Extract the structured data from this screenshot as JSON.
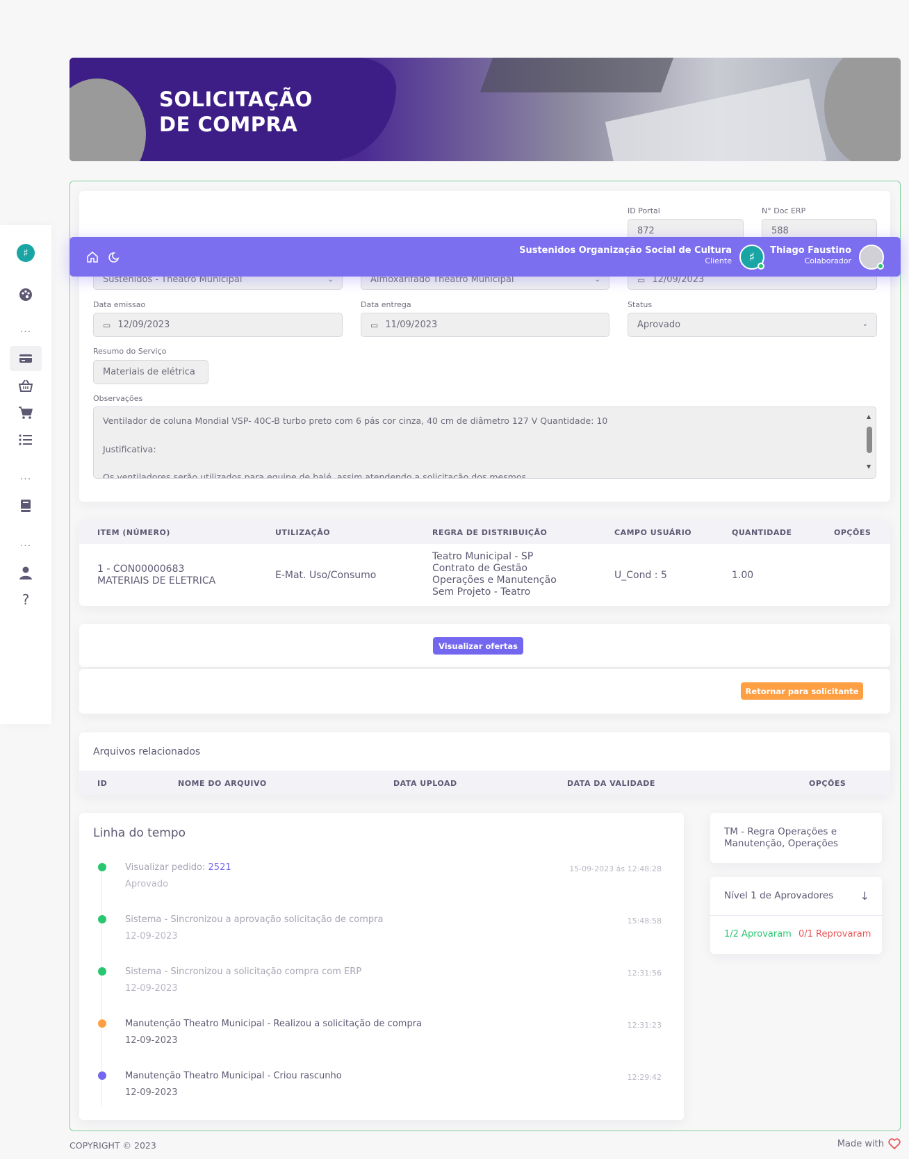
{
  "banner": {
    "title_line1": "SOLICITAÇÃO",
    "title_line2": "DE COMPRA"
  },
  "navbar": {
    "org_name": "Sustenidos Organização Social de Cultura",
    "org_role": "Cliente",
    "user_name": "Thiago Faustino",
    "user_role": "Colaborador"
  },
  "form": {
    "id_portal_label": "ID Portal",
    "id_portal_value": "872",
    "doc_erp_label": "N° Doc ERP",
    "doc_erp_value": "588",
    "filial_value": "Sustenidos - Theatro Municipal",
    "deposito_value": "Almoxarifado Theatro Municipal",
    "data_value": "12/09/2023",
    "data_emissao_label": "Data emissao",
    "data_emissao_value": "12/09/2023",
    "data_entrega_label": "Data entrega",
    "data_entrega_value": "11/09/2023",
    "status_label": "Status",
    "status_value": "Aprovado",
    "resumo_label": "Resumo do Serviço",
    "resumo_value": "Materiais de elétrica",
    "obs_label": "Observações",
    "obs_line1": "Ventilador de coluna Mondial VSP- 40C-B turbo preto com 6 pás cor cinza, 40 cm de diâmetro 127 V Quantidade: 10",
    "obs_line2": "Justificativa:",
    "obs_line3": "Os ventiladores serão utilizados para equipe de balé, assim atendendo a solicitação dos mesmos."
  },
  "items_table": {
    "headers": [
      "ITEM (NÚMERO)",
      "UTILIZAÇÃO",
      "REGRA DE DISTRIBUIÇÃO",
      "CAMPO USUÁRIO",
      "QUANTIDADE",
      "OPÇÕES"
    ],
    "row": {
      "item_line1": "1 - CON00000683",
      "item_line2": "MATERIAIS DE ELETRICA",
      "utilizacao": "E-Mat. Uso/Consumo",
      "regra_line1": "Teatro Municipal - SP",
      "regra_line2": "Contrato de Gestão",
      "regra_line3": "Operações e Manutenção",
      "regra_line4": "Sem Projeto - Teatro",
      "campo_usuario": "U_Cond : 5",
      "quantidade": "1.00"
    }
  },
  "actions": {
    "visualizar_ofertas": "Visualizar ofertas",
    "retornar": "Retornar para solicitante"
  },
  "files": {
    "title": "Arquivos relacionados",
    "headers": [
      "ID",
      "NOME DO ARQUIVO",
      "DATA UPLOAD",
      "DATA DA VALIDADE",
      "OPÇÕES"
    ]
  },
  "timeline": {
    "title": "Linha do tempo",
    "events": [
      {
        "title": "Visualizar pedido: ",
        "link": "2521",
        "sub": "Aprovado",
        "time": "15-09-2023 ás 12:48:28",
        "color": "#28c76f"
      },
      {
        "title": "Sistema - Sincronizou a aprovação solicitação de compra",
        "sub": "12-09-2023",
        "time": "15:48:58",
        "color": "#28c76f"
      },
      {
        "title": "Sistema - Sincronizou a solicitação compra com ERP",
        "sub": "12-09-2023",
        "time": "12:31:56",
        "color": "#28c76f"
      },
      {
        "title": "Manutenção Theatro Municipal - Realizou a solicitação de compra",
        "sub": "12-09-2023",
        "time": "12:31:23",
        "color": "#ff9f43"
      },
      {
        "title": "Manutenção Theatro Municipal - Criou rascunho",
        "sub": "12-09-2023",
        "time": "12:29:42",
        "color": "#7367f0"
      }
    ]
  },
  "approval": {
    "rule_line1": "TM - Regra Operações e",
    "rule_line2": "Manutenção, Operações",
    "level": "Nível 1 de Aprovadores",
    "approved": "1/2 Aprovaram",
    "rejected": "0/1 Reprovaram"
  },
  "footer": {
    "copyright": "COPYRIGHT © 2023",
    "made_with": "Made with"
  },
  "colors": {
    "primary": "#7367f0",
    "navbar": "#7b6ff0",
    "success": "#28c76f",
    "warning": "#ff9f43",
    "danger": "#ea5455",
    "banner_purple": "#3d1e86"
  }
}
